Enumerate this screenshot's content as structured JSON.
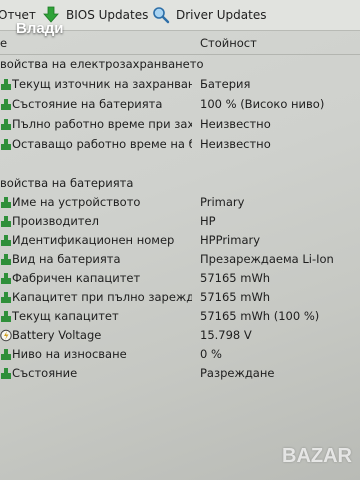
{
  "toolbar": {
    "report_label": "Отчет",
    "bios_label": "BIOS Updates",
    "driver_label": "Driver Updates",
    "user_name": "Влади"
  },
  "columns": {
    "field": "е",
    "value": "Стойност"
  },
  "sections": [
    {
      "title": "войства на електрозахранването",
      "rows": [
        {
          "icon": "power-icon",
          "field": "Текущ източник на захранване",
          "value": "Батерия"
        },
        {
          "icon": "power-icon",
          "field": "Състояние на батерията",
          "value": "100 % (Високо ниво)"
        },
        {
          "icon": "power-icon",
          "field": "Пълно работно време при зах...",
          "value": "Неизвестно"
        },
        {
          "icon": "power-icon",
          "field": "Оставащо работно време на б...",
          "value": "Неизвестно"
        }
      ]
    },
    {
      "title": "войства на батерията",
      "rows": [
        {
          "icon": "power-icon",
          "field": "Име на устройството",
          "value": "Primary"
        },
        {
          "icon": "power-icon",
          "field": "Производител",
          "value": "HP"
        },
        {
          "icon": "power-icon",
          "field": "Идентификационен номер",
          "value": "HPPrimary"
        },
        {
          "icon": "power-icon",
          "field": "Вид на батерията",
          "value": "Презареждаема Li-Ion"
        },
        {
          "icon": "power-icon",
          "field": "Фабричен капацитет",
          "value": "57165 mWh"
        },
        {
          "icon": "power-icon",
          "field": "Капацитет при пълно зарежда...",
          "value": "57165 mWh"
        },
        {
          "icon": "power-icon",
          "field": "Текущ капацитет",
          "value": "57165 mWh  (100 %)"
        },
        {
          "icon": "voltage-icon",
          "field": "Battery Voltage",
          "value": "15.798 V"
        },
        {
          "icon": "power-icon",
          "field": "Ниво на износване",
          "value": "0 %"
        },
        {
          "icon": "power-icon",
          "field": "Състояние",
          "value": "Разреждане"
        }
      ]
    }
  ],
  "watermark": "BAZAR"
}
